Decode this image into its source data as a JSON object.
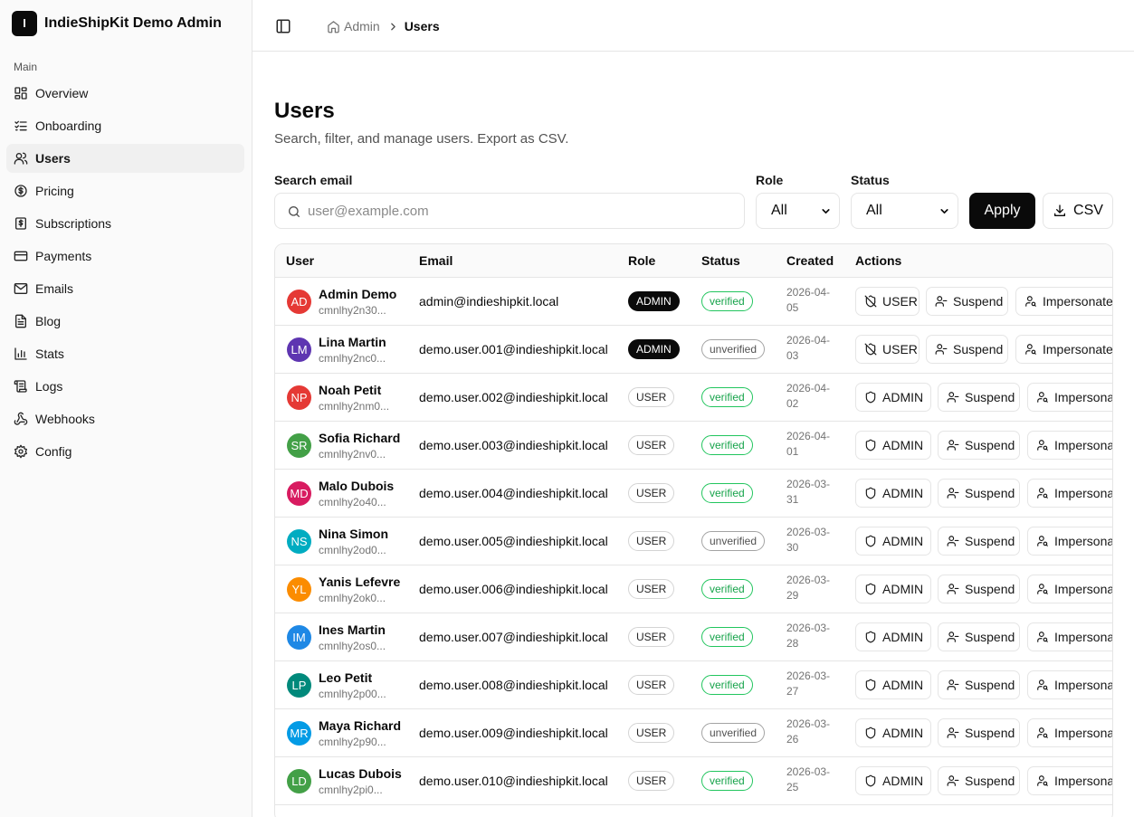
{
  "app": {
    "logo_letter": "I",
    "name": "IndieShipKit Demo Admin"
  },
  "sidebar": {
    "section": "Main",
    "items": [
      {
        "label": "Overview",
        "icon": "layout-dashboard-icon",
        "active": false
      },
      {
        "label": "Onboarding",
        "icon": "list-checks-icon",
        "active": false
      },
      {
        "label": "Users",
        "icon": "users-icon",
        "active": true
      },
      {
        "label": "Pricing",
        "icon": "circle-dollar-icon",
        "active": false
      },
      {
        "label": "Subscriptions",
        "icon": "receipt-dollar-icon",
        "active": false
      },
      {
        "label": "Payments",
        "icon": "credit-card-icon",
        "active": false
      },
      {
        "label": "Emails",
        "icon": "mail-icon",
        "active": false
      },
      {
        "label": "Blog",
        "icon": "file-text-icon",
        "active": false
      },
      {
        "label": "Stats",
        "icon": "bar-chart-icon",
        "active": false
      },
      {
        "label": "Logs",
        "icon": "scroll-text-icon",
        "active": false
      },
      {
        "label": "Webhooks",
        "icon": "webhook-icon",
        "active": false
      },
      {
        "label": "Config",
        "icon": "settings-icon",
        "active": false
      }
    ]
  },
  "header": {
    "breadcrumb": {
      "home": "Admin",
      "current": "Users"
    }
  },
  "page": {
    "title": "Users",
    "subtitle": "Search, filter, and manage users. Export as CSV."
  },
  "filters": {
    "search_label": "Search email",
    "search_placeholder": "user@example.com",
    "search_value": "",
    "role_label": "Role",
    "role_value": "All",
    "status_label": "Status",
    "status_value": "All",
    "apply_label": "Apply",
    "csv_label": "CSV"
  },
  "table": {
    "columns": {
      "user": "User",
      "email": "Email",
      "role": "Role",
      "status": "Status",
      "created": "Created",
      "actions": "Actions"
    },
    "actions": {
      "suspend": "Suspend",
      "impersonate": "Impersonate"
    },
    "rows": [
      {
        "initials": "AD",
        "avatar_color": "#e53935",
        "name": "Admin Demo",
        "id": "cmnlhy2n30...",
        "email": "admin@indieshipkit.local",
        "role": "ADMIN",
        "status": "verified",
        "created": "2026-04-05",
        "role_action": "USER"
      },
      {
        "initials": "LM",
        "avatar_color": "#5e35b1",
        "name": "Lina Martin",
        "id": "cmnlhy2nc0...",
        "email": "demo.user.001@indieshipkit.local",
        "role": "ADMIN",
        "status": "unverified",
        "created": "2026-04-03",
        "role_action": "USER"
      },
      {
        "initials": "NP",
        "avatar_color": "#e53935",
        "name": "Noah Petit",
        "id": "cmnlhy2nm0...",
        "email": "demo.user.002@indieshipkit.local",
        "role": "USER",
        "status": "verified",
        "created": "2026-04-02",
        "role_action": "ADMIN"
      },
      {
        "initials": "SR",
        "avatar_color": "#43a047",
        "name": "Sofia Richard",
        "id": "cmnlhy2nv0...",
        "email": "demo.user.003@indieshipkit.local",
        "role": "USER",
        "status": "verified",
        "created": "2026-04-01",
        "role_action": "ADMIN"
      },
      {
        "initials": "MD",
        "avatar_color": "#d81b60",
        "name": "Malo Dubois",
        "id": "cmnlhy2o40...",
        "email": "demo.user.004@indieshipkit.local",
        "role": "USER",
        "status": "verified",
        "created": "2026-03-31",
        "role_action": "ADMIN"
      },
      {
        "initials": "NS",
        "avatar_color": "#00acc1",
        "name": "Nina Simon",
        "id": "cmnlhy2od0...",
        "email": "demo.user.005@indieshipkit.local",
        "role": "USER",
        "status": "unverified",
        "created": "2026-03-30",
        "role_action": "ADMIN"
      },
      {
        "initials": "YL",
        "avatar_color": "#fb8c00",
        "name": "Yanis Lefevre",
        "id": "cmnlhy2ok0...",
        "email": "demo.user.006@indieshipkit.local",
        "role": "USER",
        "status": "verified",
        "created": "2026-03-29",
        "role_action": "ADMIN"
      },
      {
        "initials": "IM",
        "avatar_color": "#1e88e5",
        "name": "Ines Martin",
        "id": "cmnlhy2os0...",
        "email": "demo.user.007@indieshipkit.local",
        "role": "USER",
        "status": "verified",
        "created": "2026-03-28",
        "role_action": "ADMIN"
      },
      {
        "initials": "LP",
        "avatar_color": "#00897b",
        "name": "Leo Petit",
        "id": "cmnlhy2p00...",
        "email": "demo.user.008@indieshipkit.local",
        "role": "USER",
        "status": "verified",
        "created": "2026-03-27",
        "role_action": "ADMIN"
      },
      {
        "initials": "MR",
        "avatar_color": "#039be5",
        "name": "Maya Richard",
        "id": "cmnlhy2p90...",
        "email": "demo.user.009@indieshipkit.local",
        "role": "USER",
        "status": "unverified",
        "created": "2026-03-26",
        "role_action": "ADMIN"
      },
      {
        "initials": "LD",
        "avatar_color": "#43a047",
        "name": "Lucas Dubois",
        "id": "cmnlhy2pi0...",
        "email": "demo.user.010@indieshipkit.local",
        "role": "USER",
        "status": "verified",
        "created": "2026-03-25",
        "role_action": "ADMIN"
      }
    ]
  }
}
